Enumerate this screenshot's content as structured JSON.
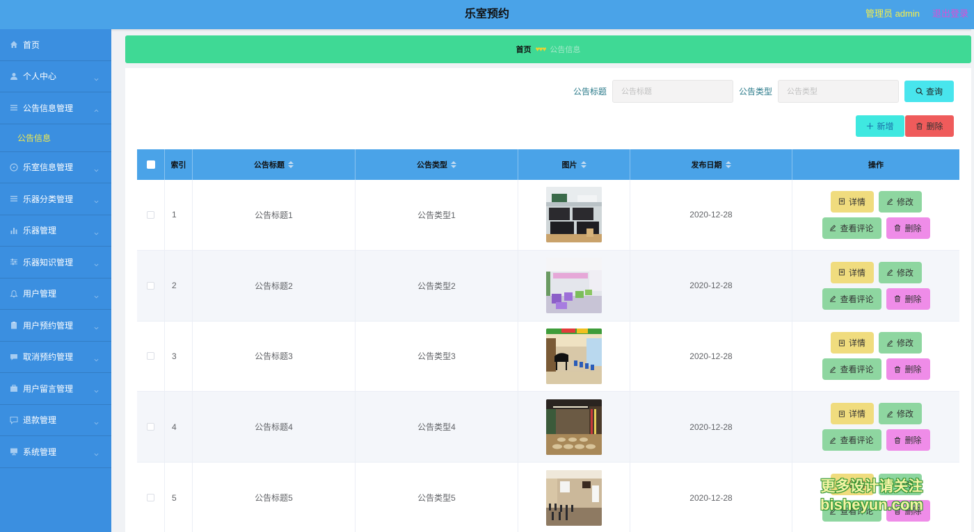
{
  "header": {
    "title": "乐室预约",
    "admin": "管理员 admin",
    "logout": "退出登录"
  },
  "sidebar": {
    "items": [
      {
        "label": "首页",
        "icon": "home-icon",
        "expandable": false
      },
      {
        "label": "个人中心",
        "icon": "user-icon",
        "expandable": true
      },
      {
        "label": "公告信息管理",
        "icon": "list-icon",
        "expandable": true,
        "expanded": true
      },
      {
        "label": "乐室信息管理",
        "icon": "compass-icon",
        "expandable": true
      },
      {
        "label": "乐器分类管理",
        "icon": "list-icon",
        "expandable": true
      },
      {
        "label": "乐器管理",
        "icon": "bar-chart-icon",
        "expandable": true
      },
      {
        "label": "乐器知识管理",
        "icon": "sliders-icon",
        "expandable": true
      },
      {
        "label": "用户管理",
        "icon": "bell-icon",
        "expandable": true
      },
      {
        "label": "用户预约管理",
        "icon": "clipboard-icon",
        "expandable": true
      },
      {
        "label": "取消预约管理",
        "icon": "message-icon",
        "expandable": true
      },
      {
        "label": "用户留言管理",
        "icon": "briefcase-icon",
        "expandable": true
      },
      {
        "label": "退款管理",
        "icon": "chat-icon",
        "expandable": true
      },
      {
        "label": "系统管理",
        "icon": "monitor-icon",
        "expandable": true
      }
    ],
    "submenu": {
      "label": "公告信息"
    }
  },
  "breadcrumb": {
    "home": "首页",
    "separator": "♥♥♥",
    "current": "公告信息"
  },
  "search": {
    "title_label": "公告标题",
    "title_placeholder": "公告标题",
    "type_label": "公告类型",
    "type_placeholder": "公告类型",
    "query_button": "查询"
  },
  "actions": {
    "add_button": "新增",
    "delete_button": "删除"
  },
  "table": {
    "columns": [
      "索引",
      "公告标题",
      "公告类型",
      "图片",
      "发布日期",
      "操作"
    ],
    "rows": [
      {
        "index": "1",
        "title": "公告标题1",
        "type": "公告类型1",
        "date": "2020-12-28"
      },
      {
        "index": "2",
        "title": "公告标题2",
        "type": "公告类型2",
        "date": "2020-12-28"
      },
      {
        "index": "3",
        "title": "公告标题3",
        "type": "公告类型3",
        "date": "2020-12-28"
      },
      {
        "index": "4",
        "title": "公告标题4",
        "type": "公告类型4",
        "date": "2020-12-28"
      },
      {
        "index": "5",
        "title": "公告标题5",
        "type": "公告类型5",
        "date": "2020-12-28"
      }
    ],
    "row_actions": {
      "detail": "详情",
      "edit": "修改",
      "review": "查看评论",
      "delete": "删除"
    }
  },
  "watermark": {
    "line1": "更多设计请关注",
    "line2": "bisheyun.com"
  },
  "colors": {
    "header": "#4aa3e8",
    "sidebar": "#3b8fe0",
    "breadcrumb": "#3fd995",
    "submenu_active": "#f2ea4e",
    "query_button": "#48e5ed",
    "add_button": "#3fe8e0",
    "delete_button": "#ef5b5b",
    "detail_button": "#f0dc7e",
    "edit_button": "#8ed6a0",
    "row_delete_button": "#ef8ce8"
  }
}
